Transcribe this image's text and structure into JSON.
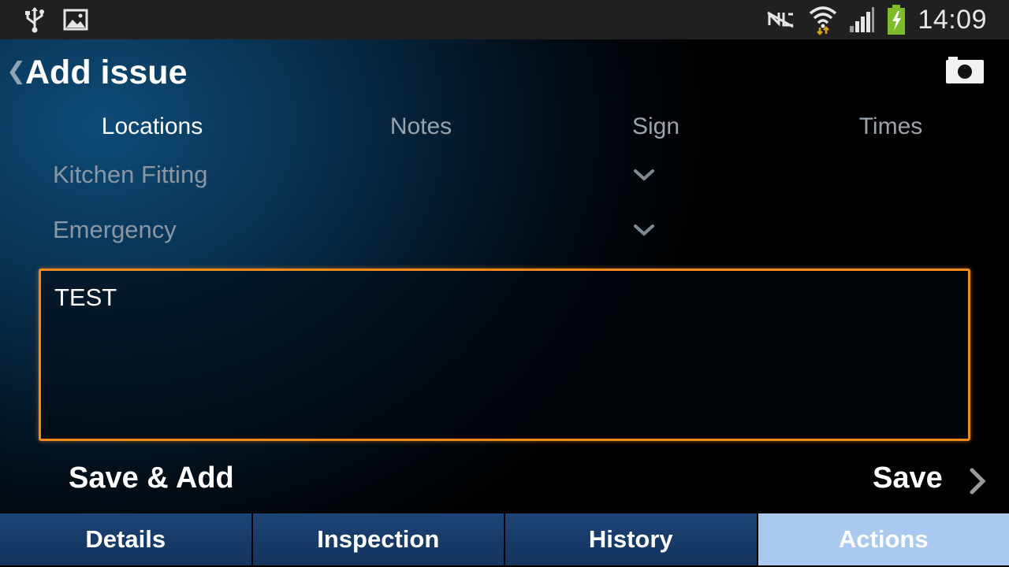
{
  "status_bar": {
    "time": "14:09",
    "icons": [
      "usb-icon",
      "image-icon",
      "nfc-icon",
      "wifi-icon",
      "signal-icon",
      "battery-charging-icon"
    ]
  },
  "header": {
    "back_icon": "back-chevron-icon",
    "title": "Add issue",
    "camera_icon": "camera-icon"
  },
  "tabs": [
    {
      "label": "Locations",
      "active": true
    },
    {
      "label": "Notes",
      "active": false
    },
    {
      "label": "Sign",
      "active": false
    },
    {
      "label": "Times",
      "active": false
    }
  ],
  "dropdowns": [
    {
      "value": "Kitchen Fitting"
    },
    {
      "value": "Emergency"
    }
  ],
  "notes_field": {
    "value": "TEST"
  },
  "actions": {
    "save_add_label": "Save & Add",
    "save_label": "Save"
  },
  "bottom_nav": [
    {
      "label": "Details",
      "active": false
    },
    {
      "label": "Inspection",
      "active": false
    },
    {
      "label": "History",
      "active": false
    },
    {
      "label": "Actions",
      "active": true
    }
  ],
  "colors": {
    "accent_orange": "#f08a1c",
    "nav_blue": "#1d4476",
    "nav_active": "#a9c9ee",
    "status_bar": "#202020"
  }
}
